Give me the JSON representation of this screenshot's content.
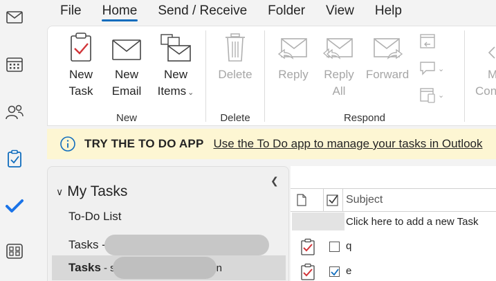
{
  "menu": [
    "File",
    "Home",
    "Send / Receive",
    "Folder",
    "View",
    "Help"
  ],
  "ribbon": {
    "new_group_label": "New",
    "new_task": [
      "New",
      "Task"
    ],
    "new_email": [
      "New",
      "Email"
    ],
    "new_items": [
      "New",
      "Items"
    ],
    "delete_group_label": "Delete",
    "delete": "Delete",
    "respond_group_label": "Respond",
    "reply": "Reply",
    "reply_all": [
      "Reply",
      "All"
    ],
    "forward": "Forward",
    "more_partial": [
      "M",
      "Con"
    ]
  },
  "infobar": {
    "title": "TRY THE TO DO APP",
    "link": "Use the To Do app to manage your tasks in Outlook"
  },
  "folders": {
    "header": "My Tasks",
    "items": [
      {
        "label": "To-Do List"
      },
      {
        "label": "Tasks -"
      },
      {
        "label": "Tasks",
        "suffix": "- s",
        "suffix_end": "n"
      }
    ]
  },
  "tasklist": {
    "subject_header": "Subject",
    "new_task_placeholder": "Click here to add a new Task",
    "rows": [
      {
        "name": "q",
        "checked": false
      },
      {
        "name": "e",
        "checked": true
      }
    ]
  },
  "colors": {
    "accent": "#0f6cbd",
    "info_bg": "#fdf6d3",
    "task_red": "#d13438"
  }
}
